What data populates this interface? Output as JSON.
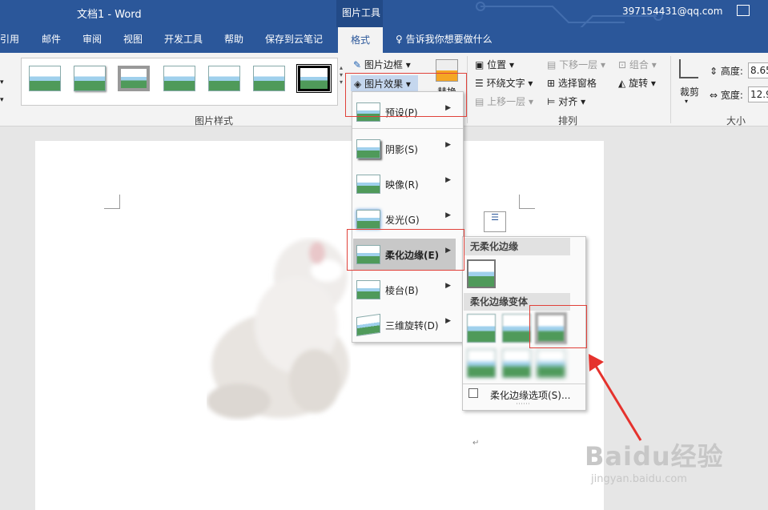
{
  "titlebar": {
    "doc_title": "文档1",
    "separator": "-",
    "app": "Word",
    "context_label": "图片工具",
    "email": "397154431@qq.com"
  },
  "tabs": [
    {
      "label": "引用"
    },
    {
      "label": "邮件"
    },
    {
      "label": "审阅"
    },
    {
      "label": "视图"
    },
    {
      "label": "开发工具"
    },
    {
      "label": "帮助"
    },
    {
      "label": "保存到云笔记"
    },
    {
      "label": "格式"
    }
  ],
  "tell_me": "告诉我你想要做什么",
  "ribbon": {
    "picture_border": "图片边框",
    "picture_effects": "图片效果",
    "replace": "替换",
    "position": "位置",
    "wrap_text": "环绕文字",
    "bring_forward": "上移一层",
    "send_backward": "下移一层",
    "selection_pane": "选择窗格",
    "align": "对齐",
    "group": "组合",
    "rotate": "旋转",
    "crop": "裁剪",
    "height_label": "高度:",
    "height_value": "8.65",
    "width_label": "宽度:",
    "width_value": "12.9",
    "group_styles": "图片样式",
    "group_arrange": "排列",
    "group_size": "大小"
  },
  "effects_menu": [
    {
      "label": "预设(P)"
    },
    {
      "label": "阴影(S)"
    },
    {
      "label": "映像(R)"
    },
    {
      "label": "发光(G)"
    },
    {
      "label": "柔化边缘(E)"
    },
    {
      "label": "棱台(B)"
    },
    {
      "label": "三维旋转(D)"
    }
  ],
  "soft_edges": {
    "no_soft": "无柔化边缘",
    "variants": "柔化边缘变体",
    "options": "柔化边缘选项(S)...",
    "dots": "⋯⋯"
  },
  "watermark": {
    "brand": "Baidu经验",
    "url": "jingyan.baidu.com"
  }
}
